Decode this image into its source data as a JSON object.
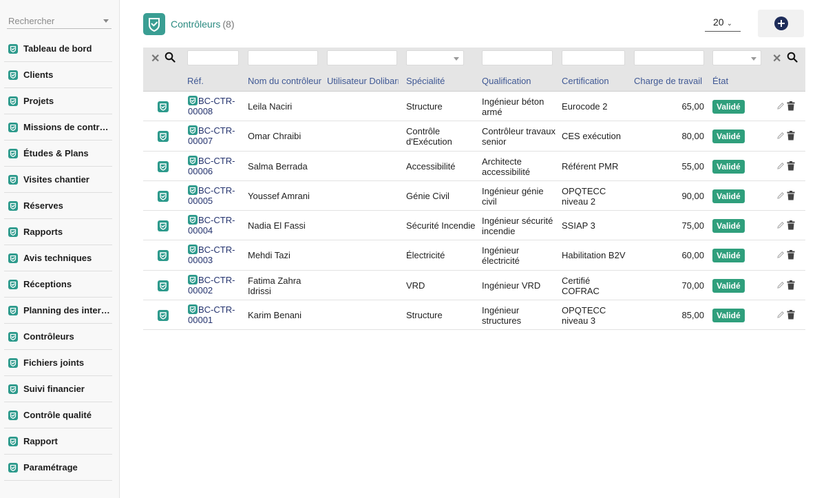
{
  "sidebar": {
    "search_placeholder": "Rechercher",
    "items": [
      {
        "label": "Tableau de bord",
        "name": "tableau-de-bord"
      },
      {
        "label": "Clients",
        "name": "clients"
      },
      {
        "label": "Projets",
        "name": "projets"
      },
      {
        "label": "Missions de contrôle",
        "name": "missions-de-controle"
      },
      {
        "label": "Études & Plans",
        "name": "etudes-plans"
      },
      {
        "label": "Visites chantier",
        "name": "visites-chantier"
      },
      {
        "label": "Réserves",
        "name": "reserves"
      },
      {
        "label": "Rapports",
        "name": "rapports"
      },
      {
        "label": "Avis techniques",
        "name": "avis-techniques"
      },
      {
        "label": "Réceptions",
        "name": "receptions"
      },
      {
        "label": "Planning des interv...",
        "name": "planning-des-interventions"
      },
      {
        "label": "Contrôleurs",
        "name": "controleurs"
      },
      {
        "label": "Fichiers joints",
        "name": "fichiers-joints"
      },
      {
        "label": "Suivi financier",
        "name": "suivi-financier"
      },
      {
        "label": "Contrôle qualité",
        "name": "controle-qualite"
      },
      {
        "label": "Rapport",
        "name": "rapport"
      },
      {
        "label": "Paramétrage",
        "name": "parametrage"
      }
    ]
  },
  "header": {
    "title": "Contrôleurs",
    "count": "(8)",
    "page_limit": "20",
    "accent_color": "#2a8a80",
    "icon": "shield-check-icon"
  },
  "table": {
    "columns": {
      "ref": "Réf.",
      "nom": "Nom du contrôleur",
      "utilisateur": "Utilisateur Dolibarr",
      "specialite": "Spécialité",
      "qualification": "Qualification",
      "certification": "Certification",
      "charge": "Charge de travail",
      "etat": "État"
    },
    "status_color": "#2f9f7c",
    "rows": [
      {
        "ref1": "BC-CTR-",
        "ref2": "00008",
        "nom1": "Leila Naciri",
        "nom2": "",
        "spec1": "Structure",
        "spec2": "",
        "qual1": "Ingénieur béton",
        "qual2": "armé",
        "cert1": "Eurocode 2",
        "cert2": "",
        "charge": "65,00",
        "etat": "Validé"
      },
      {
        "ref1": "BC-CTR-",
        "ref2": "00007",
        "nom1": "Omar Chraibi",
        "nom2": "",
        "spec1": "Contrôle",
        "spec2": "d'Exécution",
        "qual1": "Contrôleur travaux",
        "qual2": "senior",
        "cert1": "CES exécution",
        "cert2": "",
        "charge": "80,00",
        "etat": "Validé"
      },
      {
        "ref1": "BC-CTR-",
        "ref2": "00006",
        "nom1": "Salma Berrada",
        "nom2": "",
        "spec1": "Accessibilité",
        "spec2": "",
        "qual1": "Architecte",
        "qual2": "accessibilité",
        "cert1": "Référent PMR",
        "cert2": "",
        "charge": "55,00",
        "etat": "Validé"
      },
      {
        "ref1": "BC-CTR-",
        "ref2": "00005",
        "nom1": "Youssef Amrani",
        "nom2": "",
        "spec1": "Génie Civil",
        "spec2": "",
        "qual1": "Ingénieur génie",
        "qual2": "civil",
        "cert1": "OPQTECC",
        "cert2": "niveau 2",
        "charge": "90,00",
        "etat": "Validé"
      },
      {
        "ref1": "BC-CTR-",
        "ref2": "00004",
        "nom1": "Nadia El Fassi",
        "nom2": "",
        "spec1": "Sécurité Incendie",
        "spec2": "",
        "qual1": "Ingénieur sécurité",
        "qual2": "incendie",
        "cert1": "SSIAP 3",
        "cert2": "",
        "charge": "75,00",
        "etat": "Validé"
      },
      {
        "ref1": "BC-CTR-",
        "ref2": "00003",
        "nom1": "Mehdi Tazi",
        "nom2": "",
        "spec1": "Électricité",
        "spec2": "",
        "qual1": "Ingénieur",
        "qual2": "électricité",
        "cert1": "Habilitation B2V",
        "cert2": "",
        "charge": "60,00",
        "etat": "Validé"
      },
      {
        "ref1": "BC-CTR-",
        "ref2": "00002",
        "nom1": "Fatima Zahra",
        "nom2": "Idrissi",
        "spec1": "VRD",
        "spec2": "",
        "qual1": "Ingénieur VRD",
        "qual2": "",
        "cert1": "Certifié",
        "cert2": "COFRAC",
        "charge": "70,00",
        "etat": "Validé"
      },
      {
        "ref1": "BC-CTR-",
        "ref2": "00001",
        "nom1": "Karim Benani",
        "nom2": "",
        "spec1": "Structure",
        "spec2": "",
        "qual1": "Ingénieur",
        "qual2": "structures",
        "cert1": "OPQTECC",
        "cert2": "niveau 3",
        "charge": "85,00",
        "etat": "Validé"
      }
    ]
  }
}
